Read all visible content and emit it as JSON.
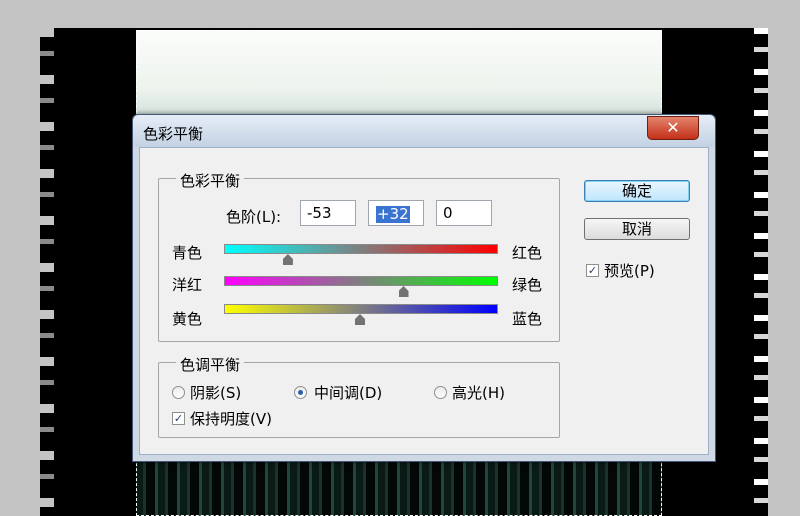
{
  "dialog": {
    "title": "色彩平衡",
    "close_glyph": "✕",
    "color_balance_group": {
      "legend": "色彩平衡",
      "levels_label": "色阶(L):",
      "levels": [
        "-53",
        "+32",
        "0"
      ],
      "sliders": [
        {
          "left": "青色",
          "right": "红色",
          "value": -53,
          "left_color": "#00ffff",
          "right_color": "#ff0000"
        },
        {
          "left": "洋红",
          "right": "绿色",
          "value": 32,
          "left_color": "#ff00ff",
          "right_color": "#00ff00"
        },
        {
          "left": "黄色",
          "right": "蓝色",
          "value": 0,
          "left_color": "#ffff00",
          "right_color": "#0000ff"
        }
      ],
      "range": [
        -100,
        100
      ]
    },
    "tone_group": {
      "legend": "色调平衡",
      "options": [
        {
          "label": "阴影(S)",
          "selected": false
        },
        {
          "label": "中间调(D)",
          "selected": true
        },
        {
          "label": "高光(H)",
          "selected": false
        }
      ],
      "preserve_luminosity": {
        "label": "保持明度(V)",
        "checked": true
      }
    },
    "buttons": {
      "ok": "确定",
      "cancel": "取消"
    },
    "preview": {
      "label": "预览(P)",
      "checked": true
    },
    "check_glyph": "✓"
  }
}
